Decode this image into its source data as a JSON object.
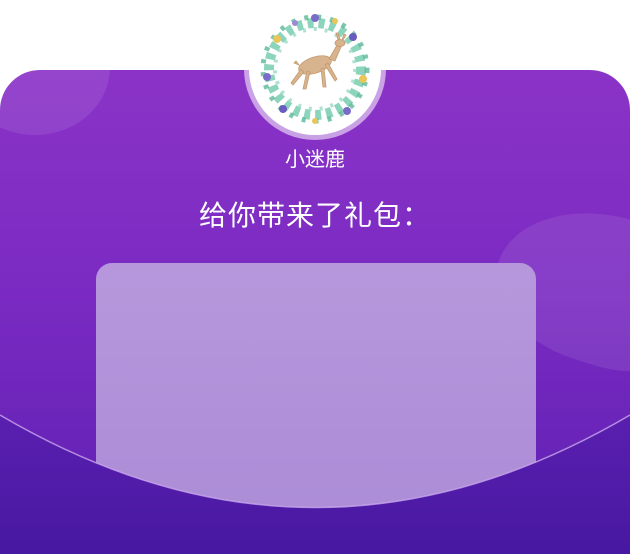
{
  "sender": {
    "name": "小迷鹿",
    "avatar_icon": "deer-wreath-icon"
  },
  "message": {
    "headline": "给你带来了礼包："
  },
  "colors": {
    "card_top": "#8b33c7",
    "card_bottom": "#5b1fb0",
    "envelope_front": "#4f1aa6",
    "gift_panel": "#b797dc"
  }
}
